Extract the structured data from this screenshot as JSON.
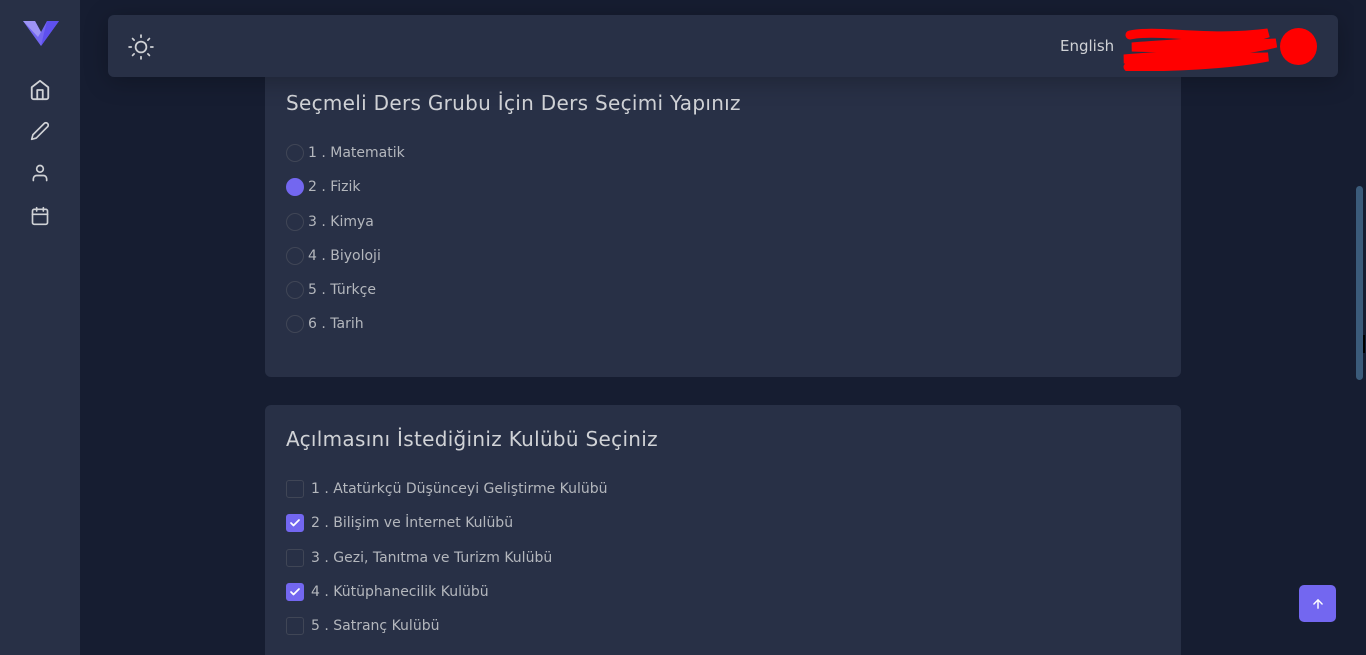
{
  "navbar": {
    "language": "English"
  },
  "card_electives": {
    "title": "Seçmeli Ders Grubu İçin Ders Seçimi Yapınız",
    "options": [
      {
        "label": "1 . Matematik",
        "checked": false
      },
      {
        "label": "2 . Fizik",
        "checked": true
      },
      {
        "label": "3 . Kimya",
        "checked": false
      },
      {
        "label": "4 . Biyoloji",
        "checked": false
      },
      {
        "label": "5 . Türkçe",
        "checked": false
      },
      {
        "label": "6 . Tarih",
        "checked": false
      }
    ]
  },
  "card_clubs": {
    "title": "Açılmasını İstediğiniz Kulübü Seçiniz",
    "options": [
      {
        "label": "1 . Atatürkçü Düşünceyi Geliştirme Kulübü",
        "checked": false
      },
      {
        "label": "2 . Bilişim ve İnternet Kulübü",
        "checked": true
      },
      {
        "label": "3 . Gezi, Tanıtma ve Turizm Kulübü",
        "checked": false
      },
      {
        "label": "4 . Kütüphanecilik Kulübü",
        "checked": true
      },
      {
        "label": "5 . Satranç Kulübü",
        "checked": false
      }
    ]
  },
  "colors": {
    "accent": "#7367f0",
    "background": "#161d31",
    "card": "#283046"
  },
  "icons": {
    "sidebar": [
      "home-icon",
      "pencil-icon",
      "user-icon",
      "calendar-icon"
    ],
    "navbar": [
      "sun-icon"
    ],
    "scroll_top": "arrow-up-icon"
  }
}
